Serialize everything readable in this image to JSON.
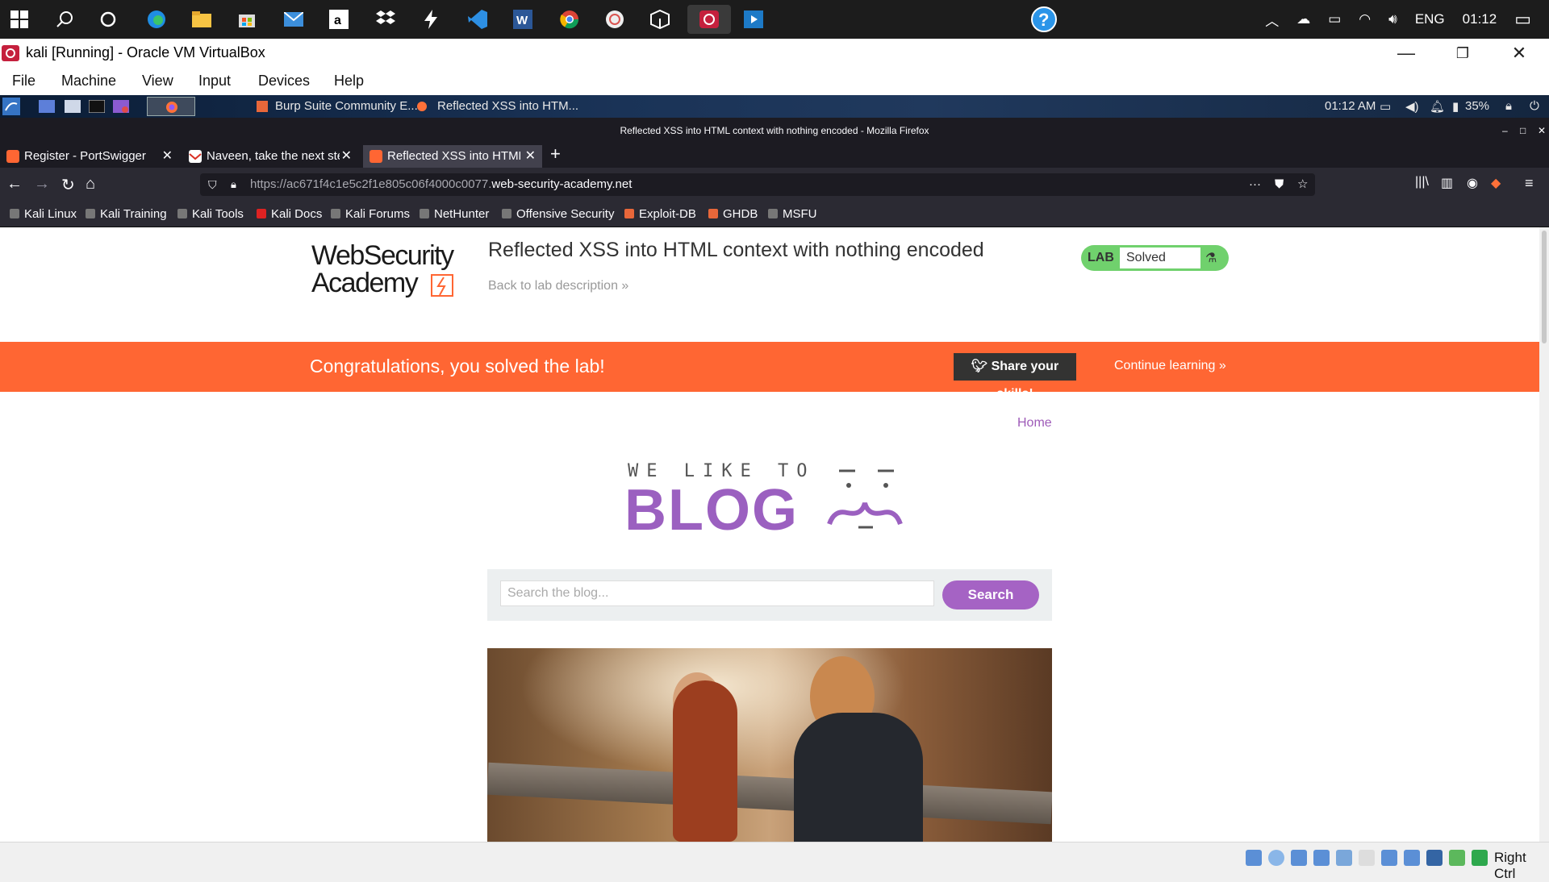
{
  "taskbar": {
    "icons": [
      "windows-start-icon",
      "search-icon",
      "cortana-icon",
      "edge-icon",
      "file-explorer-icon",
      "store-icon",
      "mail-icon",
      "amazon-icon",
      "dropbox-icon",
      "bolt-icon",
      "vscode-icon",
      "word-icon",
      "chrome-icon",
      "app-icon",
      "box-icon",
      "virtualbox-icon",
      "media-icon"
    ],
    "help_glyph": "?",
    "language": "ENG",
    "clock": "01:12"
  },
  "vbox": {
    "title": "kali [Running] - Oracle VM VirtualBox",
    "menu": [
      "File",
      "Machine",
      "View",
      "Input",
      "Devices",
      "Help"
    ],
    "host_key": "Right Ctrl"
  },
  "kali_panel": {
    "tasks": [
      "Burp Suite Community E...",
      "Reflected XSS into HTM..."
    ],
    "time": "01:12 AM",
    "battery": "35%"
  },
  "firefox": {
    "window_title": "Reflected XSS into HTML context with nothing encoded - Mozilla Firefox",
    "tabs": [
      {
        "label": "Register - PortSwigger",
        "active": false
      },
      {
        "label": "Naveen, take the next ste",
        "active": false
      },
      {
        "label": "Reflected XSS into HTML",
        "active": true
      }
    ],
    "url_prefix": "https://ac671f4c1e5c2f1e805c06f4000c0077.",
    "url_domain": "web-security-academy.net",
    "bookmarks": [
      "Kali Linux",
      "Kali Training",
      "Kali Tools",
      "Kali Docs",
      "Kali Forums",
      "NetHunter",
      "Offensive Security",
      "Exploit-DB",
      "GHDB",
      "MSFU"
    ]
  },
  "page": {
    "logo_line1": "WebSecurity",
    "logo_line2": "Academy",
    "lab_title": "Reflected XSS into HTML context with nothing encoded",
    "back_link": "Back to lab description »",
    "lab_badge": {
      "label": "LAB",
      "status": "Solved"
    },
    "banner": {
      "message": "Congratulations, you solved the lab!",
      "share_button": "Share your skills!",
      "continue_link": "Continue learning »"
    },
    "nav_home": "Home",
    "blog_tagline": "WE LIKE TO",
    "blog_word": "BLOG",
    "search": {
      "placeholder": "Search the blog...",
      "button": "Search"
    },
    "colors": {
      "banner": "#ff6633",
      "accent": "#a563c4",
      "badge": "#70d16d"
    }
  }
}
